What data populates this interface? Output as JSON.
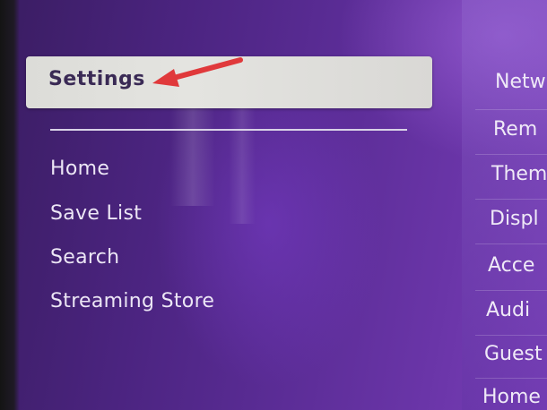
{
  "menu": {
    "selected": "Settings",
    "items": [
      "Home",
      "Save List",
      "Search",
      "Streaming Store"
    ]
  },
  "submenu": {
    "items": [
      "Netw",
      "Rem",
      "Them",
      "Displ",
      "Acce",
      "Audi",
      "Guest",
      "Home"
    ]
  },
  "colors": {
    "background": "#5a2c95",
    "selected_bar": "#e0e0dc",
    "arrow": "#e0393b"
  }
}
